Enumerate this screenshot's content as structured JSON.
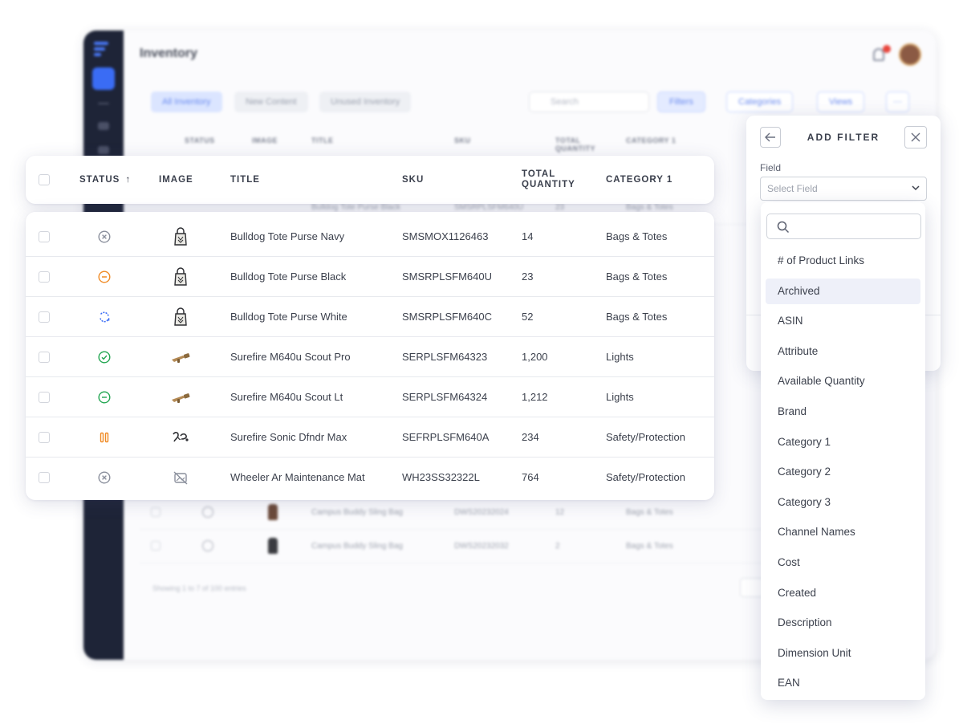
{
  "background_app": {
    "title": "Inventory",
    "tabs": [
      "All Inventory",
      "New Content",
      "Unused Inventory"
    ],
    "search_placeholder": "Search",
    "buttons": {
      "filters": "Filters",
      "categories": "Categories",
      "views": "Views",
      "more": "···"
    },
    "columns": [
      "STATUS",
      "IMAGE",
      "TITLE",
      "SKU",
      "TOTAL QUANTITY",
      "CATEGORY 1"
    ],
    "visible_rows": [
      {
        "title": "Bulldog Tote Purse Black",
        "sku": "SMSRPLSFM640U",
        "qty": "23",
        "category": "Bags & Totes"
      },
      {
        "title": "Campus Buddy Sling Bag",
        "sku": "DWS20232024",
        "qty": "12",
        "category": "Bags & Totes"
      },
      {
        "title": "Campus Buddy Sling Bag",
        "sku": "DWS20232032",
        "qty": "2",
        "category": "Bags & Totes"
      }
    ],
    "footer": "Showing 1 to 7 of 100 entries"
  },
  "table": {
    "headers": {
      "status": "STATUS",
      "status_sort": "↑",
      "image": "IMAGE",
      "title": "TITLE",
      "sku": "SKU",
      "total_quantity_line1": "TOTAL",
      "total_quantity_line2": "QUANTITY",
      "category": "CATEGORY 1"
    },
    "rows": [
      {
        "status_icon": "x-circle-icon",
        "status_color": "#8a8f9c",
        "image_icon": "tote-bag-icon",
        "title": "Bulldog Tote Purse Navy",
        "sku": "SMSMOX1126463",
        "qty": "14",
        "category": "Bags & Totes"
      },
      {
        "status_icon": "minus-circle-icon",
        "status_color": "#f08a24",
        "image_icon": "tote-bag-icon",
        "title": "Bulldog Tote Purse Black",
        "sku": "SMSRPLSFM640U",
        "qty": "23",
        "category": "Bags & Totes"
      },
      {
        "status_icon": "sync-icon",
        "status_color": "#3a6cf5",
        "image_icon": "tote-bag-icon",
        "title": "Bulldog Tote Purse White",
        "sku": "SMSRPLSFM640C",
        "qty": "52",
        "category": "Bags & Totes"
      },
      {
        "status_icon": "check-circle-icon",
        "status_color": "#22a651",
        "image_icon": "flashlight-icon",
        "title": "Surefire M640u Scout Pro",
        "sku": "SERPLSFM64323",
        "qty": "1,200",
        "category": "Lights"
      },
      {
        "status_icon": "minus-circle-icon",
        "status_color": "#22a651",
        "image_icon": "flashlight-icon",
        "title": "Surefire M640u Scout Lt",
        "sku": "SERPLSFM64324",
        "qty": "1,212",
        "category": "Lights"
      },
      {
        "status_icon": "pause-icon",
        "status_color": "#f08a24",
        "image_icon": "earplugs-icon",
        "title": "Surefire Sonic Dfndr Max",
        "sku": "SEFRPLSFM640A",
        "qty": "234",
        "category": "Safety/Protection"
      },
      {
        "status_icon": "x-circle-icon",
        "status_color": "#8a8f9c",
        "image_icon": "no-image-icon",
        "title": "Wheeler Ar Maintenance Mat",
        "sku": "WH23SS32322L",
        "qty": "764",
        "category": "Safety/Protection"
      }
    ]
  },
  "filter_panel": {
    "title": "ADD FILTER",
    "field_label": "Field",
    "field_placeholder": "Select Field",
    "search_placeholder": "",
    "options": [
      "# of Product Links",
      "Archived",
      "ASIN",
      "Attribute",
      "Available Quantity",
      "Brand",
      "Category 1",
      "Category 2",
      "Category 3",
      "Channel Names",
      "Cost",
      "Created",
      "Description",
      "Dimension Unit",
      "EAN"
    ],
    "highlighted_option": "Archived"
  },
  "colors": {
    "accent": "#3a6cf5",
    "sidebar": "#1e2437",
    "status_green": "#22a651",
    "status_orange": "#f08a24",
    "status_grey": "#8a8f9c",
    "highlight": "#eef0f9"
  }
}
